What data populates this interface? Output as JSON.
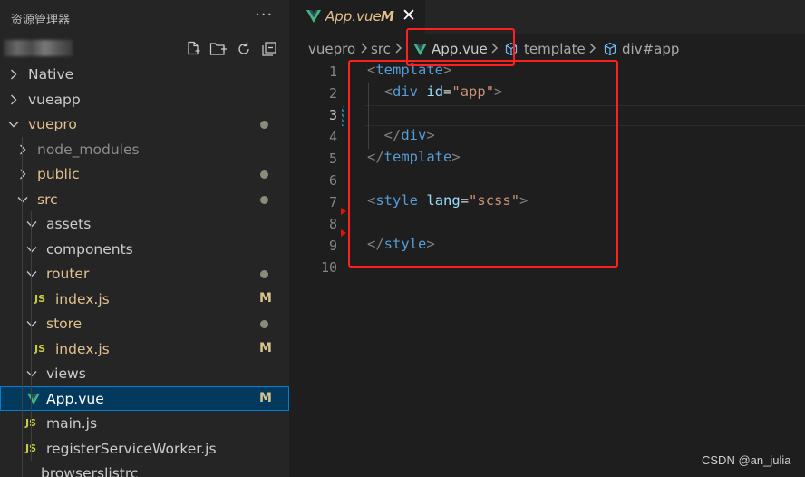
{
  "sidebar": {
    "title": "资源管理器",
    "more": "···",
    "tree": [
      {
        "label": "Native",
        "kind": "folder",
        "depth": 0,
        "open": false,
        "color": "#cccccc"
      },
      {
        "label": "vueapp",
        "kind": "folder",
        "depth": 0,
        "open": false,
        "color": "#cccccc"
      },
      {
        "label": "vuepro",
        "kind": "folder",
        "depth": 0,
        "open": true,
        "color": "#e2c08d",
        "dot": true
      },
      {
        "label": "node_modules",
        "kind": "folder",
        "depth": 1,
        "open": false,
        "color": "#8c8c8c"
      },
      {
        "label": "public",
        "kind": "folder",
        "depth": 1,
        "open": false,
        "color": "#e2c08d",
        "dot": true
      },
      {
        "label": "src",
        "kind": "folder",
        "depth": 1,
        "open": true,
        "color": "#e2c08d",
        "dot": true
      },
      {
        "label": "assets",
        "kind": "folder",
        "depth": 2,
        "open": true,
        "color": "#cccccc"
      },
      {
        "label": "components",
        "kind": "folder",
        "depth": 2,
        "open": true,
        "color": "#cccccc"
      },
      {
        "label": "router",
        "kind": "folder",
        "depth": 2,
        "open": true,
        "color": "#e2c08d",
        "dot": true
      },
      {
        "label": "index.js",
        "kind": "js",
        "depth": 3,
        "color": "#e2c08d",
        "badge": "M"
      },
      {
        "label": "store",
        "kind": "folder",
        "depth": 2,
        "open": true,
        "color": "#e2c08d",
        "dot": true
      },
      {
        "label": "index.js",
        "kind": "js",
        "depth": 3,
        "color": "#e2c08d",
        "badge": "M"
      },
      {
        "label": "views",
        "kind": "folder",
        "depth": 2,
        "open": true,
        "color": "#cccccc"
      },
      {
        "label": "App.vue",
        "kind": "vue",
        "depth": 2,
        "color": "#e2c08d",
        "badge": "M",
        "selected": true
      },
      {
        "label": "main.js",
        "kind": "js",
        "depth": 2,
        "color": "#cccccc"
      },
      {
        "label": "registerServiceWorker.js",
        "kind": "js",
        "depth": 2,
        "color": "#cccccc"
      },
      {
        "label": "browserslistrc",
        "kind": "file",
        "depth": 1,
        "color": "#cccccc"
      }
    ]
  },
  "editor": {
    "tab": {
      "name": "App.vue",
      "modified": "M"
    },
    "breadcrumb": {
      "items": [
        "vuepro",
        "src",
        "App.vue",
        "template",
        "div#app"
      ]
    },
    "line_numbers": [
      "1",
      "2",
      "3",
      "4",
      "5",
      "6",
      "7",
      "8",
      "9",
      "10"
    ],
    "active_line": 3,
    "code": {
      "l1": {
        "open": "<",
        "tag": "template",
        "close": ">"
      },
      "l2": {
        "open": "<",
        "tag": "div",
        "attr": "id",
        "eq": "=",
        "val": "\"app\"",
        "close": ">"
      },
      "l4": {
        "open": "</",
        "tag": "div",
        "close": ">"
      },
      "l5": {
        "open": "</",
        "tag": "template",
        "close": ">"
      },
      "l7": {
        "open": "<",
        "tag": "style",
        "attr": "lang",
        "eq": "=",
        "val": "\"scss\"",
        "close": ">"
      },
      "l9": {
        "open": "</",
        "tag": "style",
        "close": ">"
      }
    }
  },
  "watermark": "CSDN @an_julia"
}
